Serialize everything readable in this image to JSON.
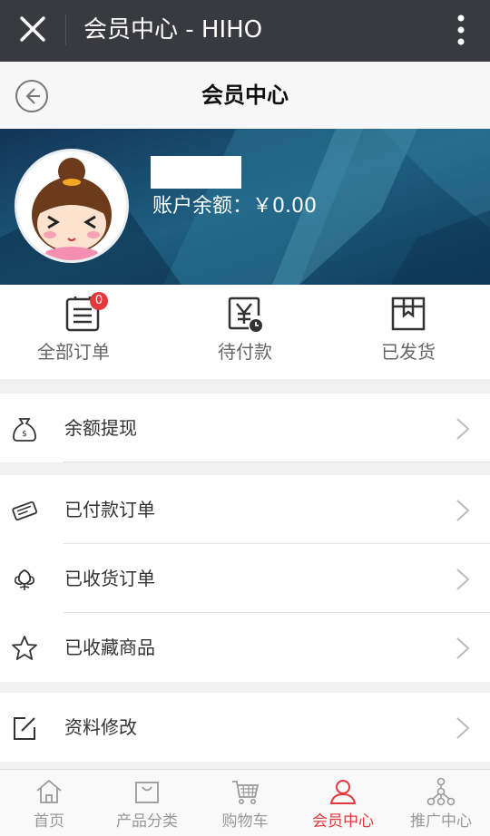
{
  "topbar": {
    "title": "会员中心 - HIHO",
    "close_icon": "close-icon",
    "more_icon": "more-vertical-icon"
  },
  "navbar": {
    "title": "会员中心",
    "back_icon": "back-arrow-icon"
  },
  "profile": {
    "balance_label": "账户余额：￥0.00",
    "avatar": "cartoon-girl-avatar"
  },
  "orders": [
    {
      "label": "全部订单",
      "icon": "order-list-icon",
      "badge": "0"
    },
    {
      "label": "待付款",
      "icon": "pending-payment-icon"
    },
    {
      "label": "已发货",
      "icon": "shipped-box-icon"
    }
  ],
  "menu": {
    "withdraw": "余额提现",
    "paid_orders": "已付款订单",
    "received_orders": "已收货订单",
    "favorites": "已收藏商品",
    "profile_edit": "资料修改"
  },
  "tabs": [
    {
      "label": "首页",
      "icon": "home-icon"
    },
    {
      "label": "产品分类",
      "icon": "bag-icon"
    },
    {
      "label": "购物车",
      "icon": "cart-icon"
    },
    {
      "label": "会员中心",
      "icon": "user-icon",
      "active": true
    },
    {
      "label": "推广中心",
      "icon": "network-icon"
    }
  ],
  "colors": {
    "accent": "#e4393c",
    "topbar": "#393a3f",
    "banner": "#1a4a6a"
  }
}
